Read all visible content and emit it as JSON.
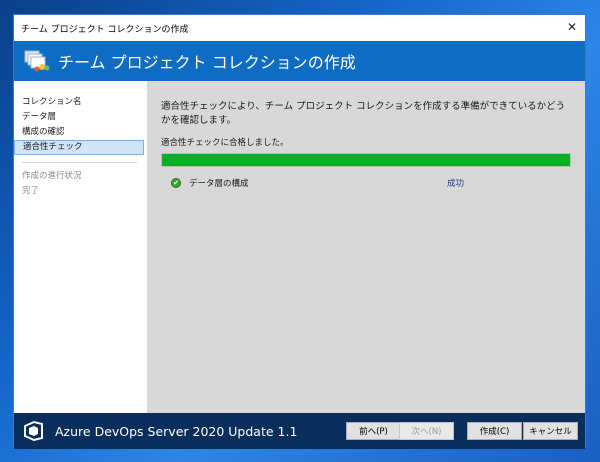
{
  "window": {
    "title": "チーム プロジェクト コレクションの作成",
    "close_glyph": "✕"
  },
  "banner": {
    "title": "チーム プロジェクト コレクションの作成"
  },
  "sidebar": {
    "steps": [
      {
        "label": "コレクション名",
        "state": "normal"
      },
      {
        "label": "データ層",
        "state": "normal"
      },
      {
        "label": "構成の確認",
        "state": "normal"
      },
      {
        "label": "適合性チェック",
        "state": "active"
      }
    ],
    "later_steps": [
      {
        "label": "作成の進行状況",
        "state": "disabled"
      },
      {
        "label": "完了",
        "state": "disabled"
      }
    ]
  },
  "main": {
    "description": "適合性チェックにより、チーム プロジェクト コレクションを作成する準備ができているかどうかを確認します。",
    "status": "適合性チェックに合格しました。",
    "progress": 1.0,
    "checks": [
      {
        "name": "データ層の構成",
        "result": "成功",
        "icon": "success-check-icon"
      }
    ]
  },
  "footer": {
    "product": "Azure DevOps Server 2020 Update 1.1",
    "buttons": {
      "previous": "前へ(P)",
      "next": "次へ(N)",
      "create": "作成(C)",
      "cancel": "キャンセル"
    }
  },
  "colors": {
    "banner": "#0f6cc3",
    "footer": "#0a2e5c",
    "progress": "#06b025",
    "selected_step": "#cfe4f7"
  }
}
